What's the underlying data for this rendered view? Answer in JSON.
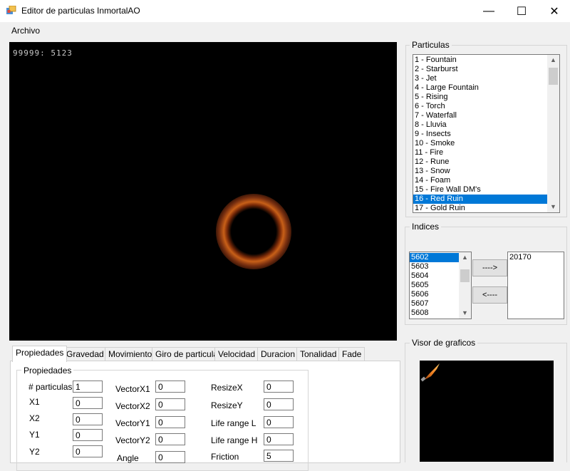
{
  "window": {
    "title": "Editor de particulas InmortalAO",
    "minimize_glyph": "—",
    "maximize_glyph": "☐",
    "close_glyph": "✕"
  },
  "menu": {
    "archivo": "Archivo"
  },
  "viewport": {
    "counter": "99999:  5123"
  },
  "particulas": {
    "title": "Particulas",
    "items": [
      "1 - Fountain",
      "2 - Starburst",
      "3 - Jet",
      "4 - Large Fountain",
      "5 - Rising",
      "6 - Torch",
      "7 - Waterfall",
      "8 - Lluvia",
      "9 - Insects",
      "10 - Smoke",
      "11 - Fire",
      "12 - Rune",
      "13 - Snow",
      "14 - Foam",
      "15 - Fire Wall DM's",
      "16 - Red Ruin",
      "17 - Gold Ruin"
    ],
    "selected_index": 15
  },
  "indices": {
    "title": "Indices",
    "items": [
      "5602",
      "5603",
      "5604",
      "5605",
      "5606",
      "5607",
      "5608"
    ],
    "selected_index": 0,
    "add_button": "---->",
    "remove_button": "<----",
    "target_items": [
      "20170"
    ]
  },
  "tabs": [
    "Propiedades",
    "Gravedad",
    "Movimiento",
    "Giro de particula",
    "Velocidad",
    "Duracion",
    "Tonalidad",
    "Fade"
  ],
  "active_tab": 0,
  "propiedades": {
    "group_title": "Propiedades",
    "num_particulas_label": "# particulas",
    "num_particulas": "1",
    "x1_label": "X1",
    "x1": "0",
    "x2_label": "X2",
    "x2": "0",
    "y1_label": "Y1",
    "y1": "0",
    "y2_label": "Y2",
    "y2": "0",
    "vectorx1_label": "VectorX1",
    "vectorx1": "0",
    "vectorx2_label": "VectorX2",
    "vectorx2": "0",
    "vectory1_label": "VectorY1",
    "vectory1": "0",
    "vectory2_label": "VectorY2",
    "vectory2": "0",
    "angle_label": "Angle",
    "angle": "0",
    "resizex_label": "ResizeX",
    "resizex": "0",
    "resizey_label": "ResizeY",
    "resizey": "0",
    "liferangel_label": "Life range L",
    "liferangel": "0",
    "liferangeh_label": "Life range H",
    "liferangeh": "0",
    "friction_label": "Friction",
    "friction": "5"
  },
  "visor": {
    "title": "Visor de graficos"
  },
  "colors": {
    "selection": "#0078d7",
    "viewport_bg": "#000000",
    "ring": "#c86018"
  }
}
